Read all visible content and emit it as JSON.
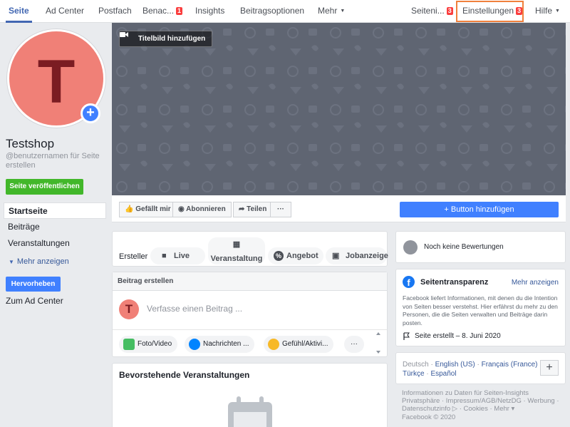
{
  "nav": {
    "items": [
      {
        "label": "Seite",
        "active": true
      },
      {
        "label": "Ad Center"
      },
      {
        "label": "Postfach"
      },
      {
        "label": "Benac...",
        "badge": "1"
      },
      {
        "label": "Insights"
      },
      {
        "label": "Beitragsoptionen"
      },
      {
        "label": "Mehr",
        "caret": true
      }
    ],
    "right": [
      {
        "label": "Seiteni...",
        "badge": "3"
      },
      {
        "label": "Einstellungen",
        "badge": "3"
      },
      {
        "label": "Hilfe",
        "caret": true
      }
    ]
  },
  "profile": {
    "initial": "T",
    "name": "Testshop",
    "username": "@benutzernamen für Seite erstellen",
    "publish_label": "Seite veröffentlichen"
  },
  "left_nav": {
    "items": [
      "Startseite",
      "Beiträge",
      "Veranstaltungen"
    ],
    "more_label": "Mehr anzeigen",
    "highlight_label": "Hervorheben",
    "adcenter_label": "Zum Ad Center"
  },
  "cover": {
    "add_cover_label": "Titelbild hinzufügen"
  },
  "actions": {
    "like": "Gefällt mir",
    "follow": "Abonnieren",
    "share": "Teilen",
    "more": "···",
    "add_button": "+ Button hinzufügen"
  },
  "creator": {
    "label": "Ersteller",
    "items": [
      "Live",
      "Veranstaltung",
      "Angebot",
      "Jobanzeige"
    ]
  },
  "composer": {
    "header": "Beitrag erstellen",
    "placeholder": "Verfasse einen Beitrag ...",
    "chips": [
      "Foto/Video",
      "Nachrichten ...",
      "Gefühl/Aktivi...",
      "···"
    ]
  },
  "events": {
    "title": "Bevorstehende Veranstaltungen"
  },
  "reviews": {
    "text": "Noch keine Bewertungen"
  },
  "transparency": {
    "title": "Seitentransparenz",
    "more": "Mehr anzeigen",
    "description": "Facebook liefert Informationen, mit denen du die Intention von Seiten besser verstehst. Hier erfährst du mehr zu den Personen, die die Seiten verwalten und Beiträge darin posten.",
    "created": "Seite erstellt – 8. Juni 2020"
  },
  "languages": {
    "current": "Deutsch",
    "links": [
      "English (US)",
      "Français (France)",
      "Türkçe",
      "Español"
    ],
    "plus": "+"
  },
  "footer": {
    "line1": "Informationen zu Daten für Seiten-Insights",
    "line2": "Privatsphäre · Impressum/AGB/NetzDG · Werbung ·",
    "line3": "Datenschutzinfo ▷ · Cookies · Mehr ▾",
    "line4": "Facebook © 2020"
  },
  "colors": {
    "brand_blue": "#4080ff",
    "publish_green": "#42b72a",
    "highlight_orange": "#f0803c",
    "avatar_bg": "#f08077",
    "cover_bg": "#5f6572"
  }
}
